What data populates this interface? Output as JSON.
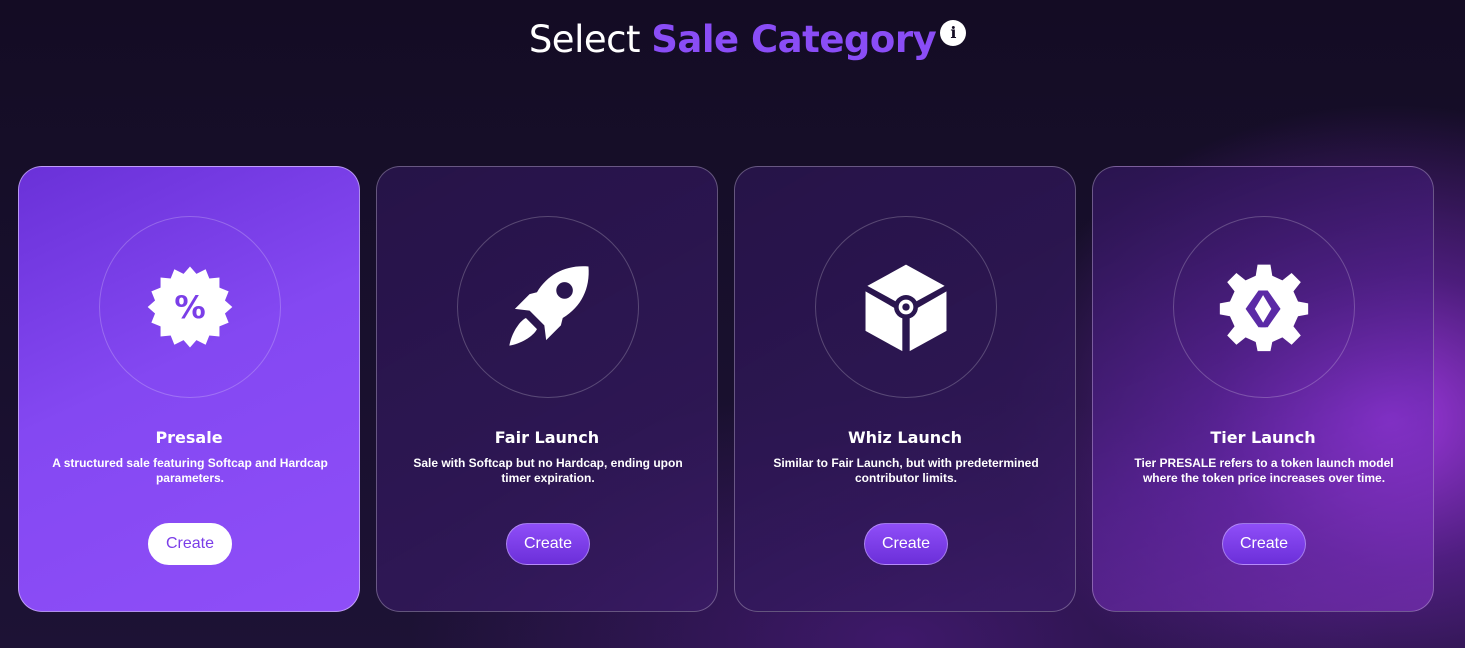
{
  "header": {
    "title_plain": "Select",
    "title_accent": "Sale Category",
    "info_glyph": "i"
  },
  "colors": {
    "accent": "#8a4df6",
    "active_card": "#8448f2",
    "background": "#140c24",
    "button_gradient_top": "#8f4ef8"
  },
  "cards": [
    {
      "icon": "discount-badge-icon",
      "title": "Presale",
      "description": "A structured sale featuring Softcap and Hardcap parameters.",
      "button_label": "Create",
      "selected": true
    },
    {
      "icon": "rocket-icon",
      "title": "Fair Launch",
      "description": "Sale with Softcap but no Hardcap, ending upon timer expiration.",
      "button_label": "Create",
      "selected": false
    },
    {
      "icon": "box-icon",
      "title": "Whiz Launch",
      "description": "Similar to Fair Launch, but with predetermined contributor limits.",
      "button_label": "Create",
      "selected": false
    },
    {
      "icon": "gear-code-icon",
      "title": "Tier Launch",
      "description": "Tier PRESALE refers to a token launch model where the token price increases over time.",
      "button_label": "Create",
      "selected": false
    }
  ]
}
